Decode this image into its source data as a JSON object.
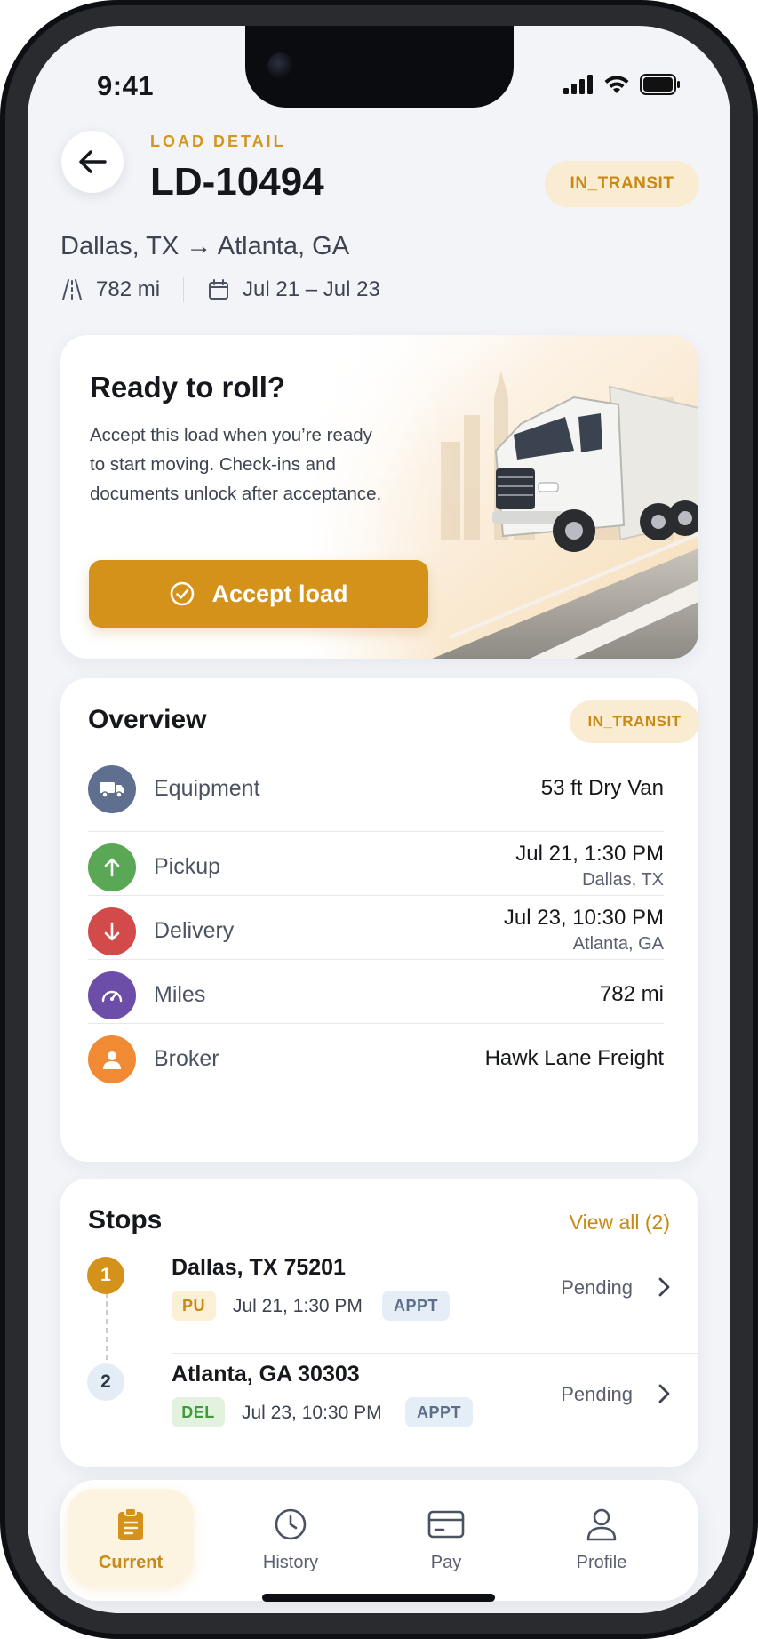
{
  "status_bar": {
    "time": "9:41"
  },
  "header": {
    "eyebrow": "LOAD DETAIL",
    "load_id": "LD-10494",
    "status": "IN_TRANSIT",
    "route": "Dallas, TX → Atlanta, GA",
    "distance": "782 mi",
    "dates": "Jul 21 – Jul 23"
  },
  "hero": {
    "title": "Ready to roll?",
    "body": "Accept this load when you’re ready to start moving. Check-ins and documents unlock after acceptance.",
    "button_label": "Accept load"
  },
  "overview": {
    "title": "Overview",
    "status": "IN_TRANSIT",
    "rows": [
      {
        "label": "Equipment",
        "value": "53 ft Dry Van",
        "sub": "",
        "icon": "truck-icon",
        "color": "#5e6f8f"
      },
      {
        "label": "Pickup",
        "value": "Jul 21, 1:30 PM",
        "sub": "Dallas, TX",
        "icon": "arrow-up-icon",
        "color": "#5aa856"
      },
      {
        "label": "Delivery",
        "value": "Jul 23, 10:30 PM",
        "sub": "Atlanta, GA",
        "icon": "arrow-down-icon",
        "color": "#d24a49"
      },
      {
        "label": "Miles",
        "value": "782 mi",
        "sub": "",
        "icon": "speedometer-icon",
        "color": "#6c4ea8"
      },
      {
        "label": "Broker",
        "value": "Hawk Lane Freight",
        "sub": "",
        "icon": "person-icon",
        "color": "#f08a35"
      }
    ]
  },
  "stops": {
    "title": "Stops",
    "view_all": "View all (2)",
    "items": [
      {
        "number": "1",
        "city": "Dallas, TX 75201",
        "type": "PU",
        "time": "Jul 21, 1:30 PM",
        "appt": "APPT",
        "status": "Pending"
      },
      {
        "number": "2",
        "city": "Atlanta, GA 30303",
        "type": "DEL",
        "time": "Jul 23, 10:30 PM",
        "appt": "APPT",
        "status": "Pending"
      }
    ]
  },
  "tabbar": {
    "tabs": [
      {
        "label": "Current",
        "icon": "clipboard-icon",
        "active": true
      },
      {
        "label": "History",
        "icon": "clock-icon",
        "active": false
      },
      {
        "label": "Pay",
        "icon": "credit-card-icon",
        "active": false
      },
      {
        "label": "Profile",
        "icon": "profile-icon",
        "active": false
      }
    ]
  },
  "colors": {
    "accent": "#d4921a",
    "status_pill_bg": "#faecd2",
    "background": "#f2f4f8"
  }
}
